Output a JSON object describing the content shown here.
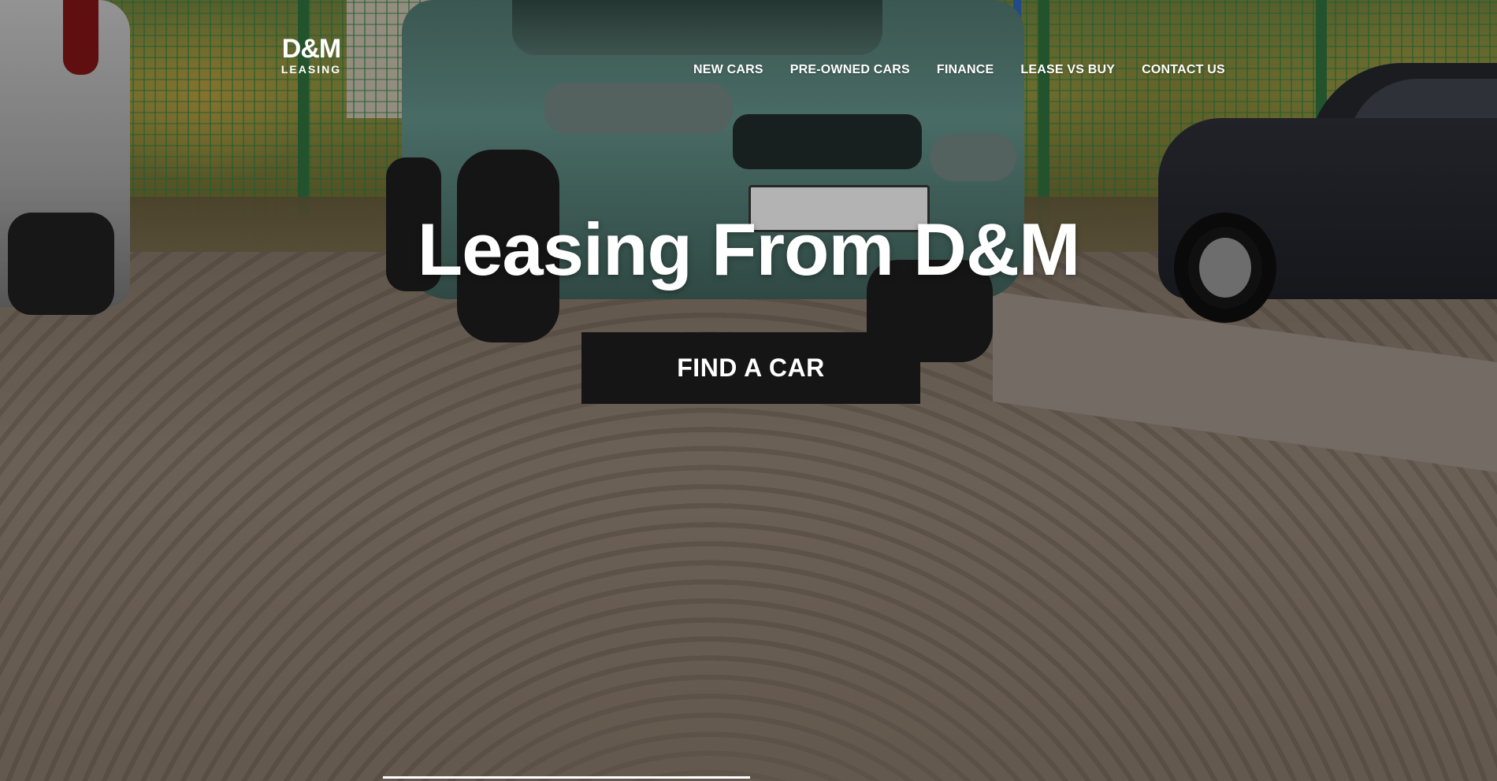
{
  "brand": {
    "logo_mark": "D&M",
    "logo_sub": "LEASING"
  },
  "nav": {
    "items": [
      {
        "label": "NEW CARS"
      },
      {
        "label": "PRE-OWNED CARS"
      },
      {
        "label": "FINANCE"
      },
      {
        "label": "LEASE VS BUY"
      },
      {
        "label": "CONTACT US"
      }
    ]
  },
  "hero": {
    "title": "Leasing From D&M",
    "cta_label": "FIND A CAR",
    "background": "photo of parked cars on a dirt lot"
  },
  "colors": {
    "text": "#ffffff",
    "button_bg": "#151515"
  }
}
